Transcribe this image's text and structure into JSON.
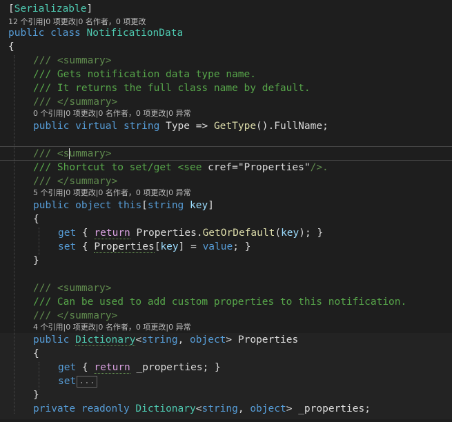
{
  "code": {
    "attribute": "Serializable",
    "class_lens": "12 个引用|0 项更改|0 名作者，0 项更改",
    "class_decl": {
      "mod": "public",
      "kw": "class",
      "name": "NotificationData"
    },
    "brace_open": "{",
    "brace_close": "}",
    "type_doc": {
      "l1": "/// <summary>",
      "l2": "/// Gets notification data type name.",
      "l3": "/// It returns the full class name by default.",
      "l4": "/// </summary>"
    },
    "type_lens": "0 个引用|0 项更改|0 名作者，0 项更改|0 异常",
    "type_prop": {
      "mod": "public",
      "virt": "virtual",
      "type": "string",
      "name": "Type",
      "arrow": " => ",
      "call": "GetType",
      "paren": "()",
      "dot": ".",
      "member": "FullName",
      "end": ";"
    },
    "indexer_doc": {
      "l1_pre": "/// <s",
      "l1_post": "ummary>",
      "l2_pre": "/// Shortcut to set/get <see ",
      "l2_attr": "cref=",
      "l2_val": "\"Properties\"",
      "l2_end": "/>.",
      "l3": "/// </summary>"
    },
    "indexer_lens": "5 个引用|0 项更改|0 名作者，0 项更改|0 异常",
    "indexer": {
      "mod": "public",
      "type": "object",
      "this": "this",
      "lb": "[",
      "ptype": "string",
      "pname": "key",
      "rb": "]",
      "get_kw": "get",
      "get_open": " { ",
      "get_ret": "return",
      "get_obj": "Properties",
      "get_dot": ".",
      "get_call": "GetOrDefault",
      "get_lp": "(",
      "get_arg": "key",
      "get_rp": ");",
      "get_close": " }",
      "set_kw": "set",
      "set_open": " { ",
      "set_obj": "Properties",
      "set_lb": "[",
      "set_arg": "key",
      "set_rb": "] = ",
      "set_val": "value",
      "set_close": "; }"
    },
    "props_doc": {
      "l1": "/// <summary>",
      "l2": "/// Can be used to add custom properties to this notification.",
      "l3": "/// </summary>"
    },
    "props_lens": "4 个引用|0 项更改|0 名作者，0 项更改|0 异常",
    "props": {
      "mod": "public",
      "dict": "Dictionary",
      "lt": "<",
      "t1": "string",
      "comma": ", ",
      "t2": "object",
      "gt": "> ",
      "name": "Properties",
      "get_kw": "get",
      "get_open": " { ",
      "get_ret": "return",
      "get_field": " _properties",
      "get_close": "; }",
      "set_kw": "set",
      "set_collapsed": "..."
    },
    "field": {
      "mod": "private",
      "ro": "readonly",
      "dict": "Dictionary",
      "lt": "<",
      "t1": "string",
      "comma": ", ",
      "t2": "object",
      "gt": "> ",
      "name": "_properties",
      "end": ";"
    }
  }
}
